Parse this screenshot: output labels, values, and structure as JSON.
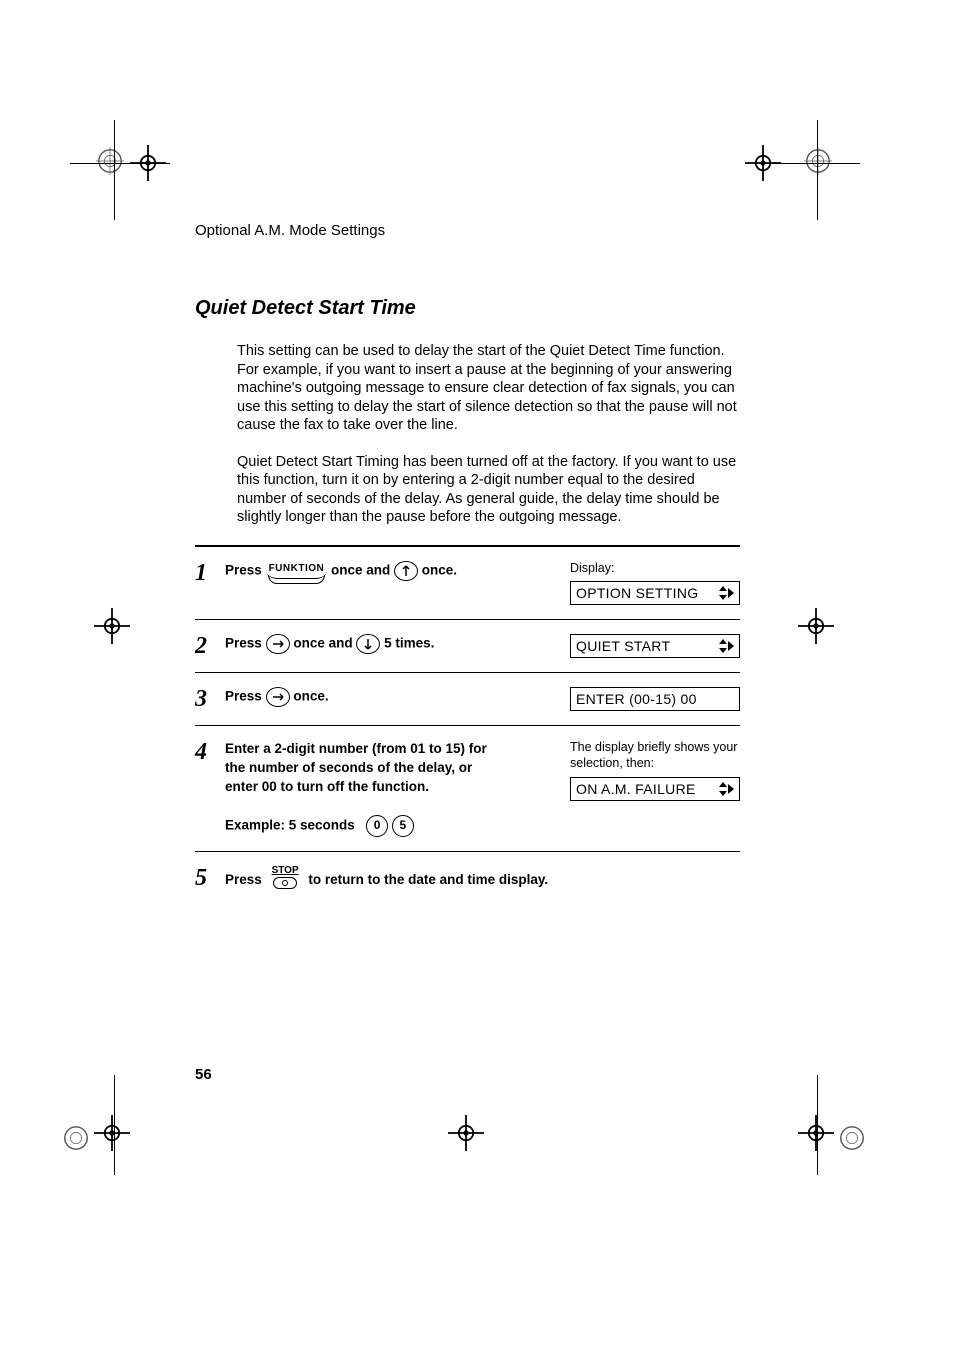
{
  "header": {
    "running": "Optional A.M. Mode Settings"
  },
  "title": "Quiet Detect Start Time",
  "para1": "This setting can be used to delay the start of the Quiet Detect Time function. For example, if you want to insert a pause at the beginning of your answering machine's outgoing message to ensure clear detection of fax signals, you can use this setting to delay the start of silence detection so that the pause will not cause the fax to take over the line.",
  "para2": "Quiet Detect Start Timing has been turned off at the factory. If you want to use this function, turn it on  by entering a 2-digit number equal to the desired number of seconds of the delay. As general guide, the delay time should be slightly longer than the pause before the outgoing message.",
  "steps": {
    "s1": {
      "press": "Press",
      "func_label": "FUNKTION",
      "mid": " once and ",
      "tail": " once.",
      "display_label": "Display:",
      "lcd": "OPTION SETTING"
    },
    "s2": {
      "press": "Press",
      "mid": " once and ",
      "tail": " 5 times.",
      "lcd": "QUIET START"
    },
    "s3": {
      "press": "Press",
      "tail": " once.",
      "lcd": "ENTER (00-15) 00"
    },
    "s4": {
      "body": "Enter a 2-digit number (from 01 to 15) for the number of seconds of the delay, or enter 00 to turn off the function.",
      "example_label": "Example: 5 seconds",
      "key0": "0",
      "key5": "5",
      "note": "The display briefly shows your selection, then:",
      "lcd": "ON A.M. FAILURE"
    },
    "s5": {
      "press": "Press",
      "stop_label": "STOP",
      "tail": " to return to the date and time display."
    }
  },
  "page_number": "56"
}
